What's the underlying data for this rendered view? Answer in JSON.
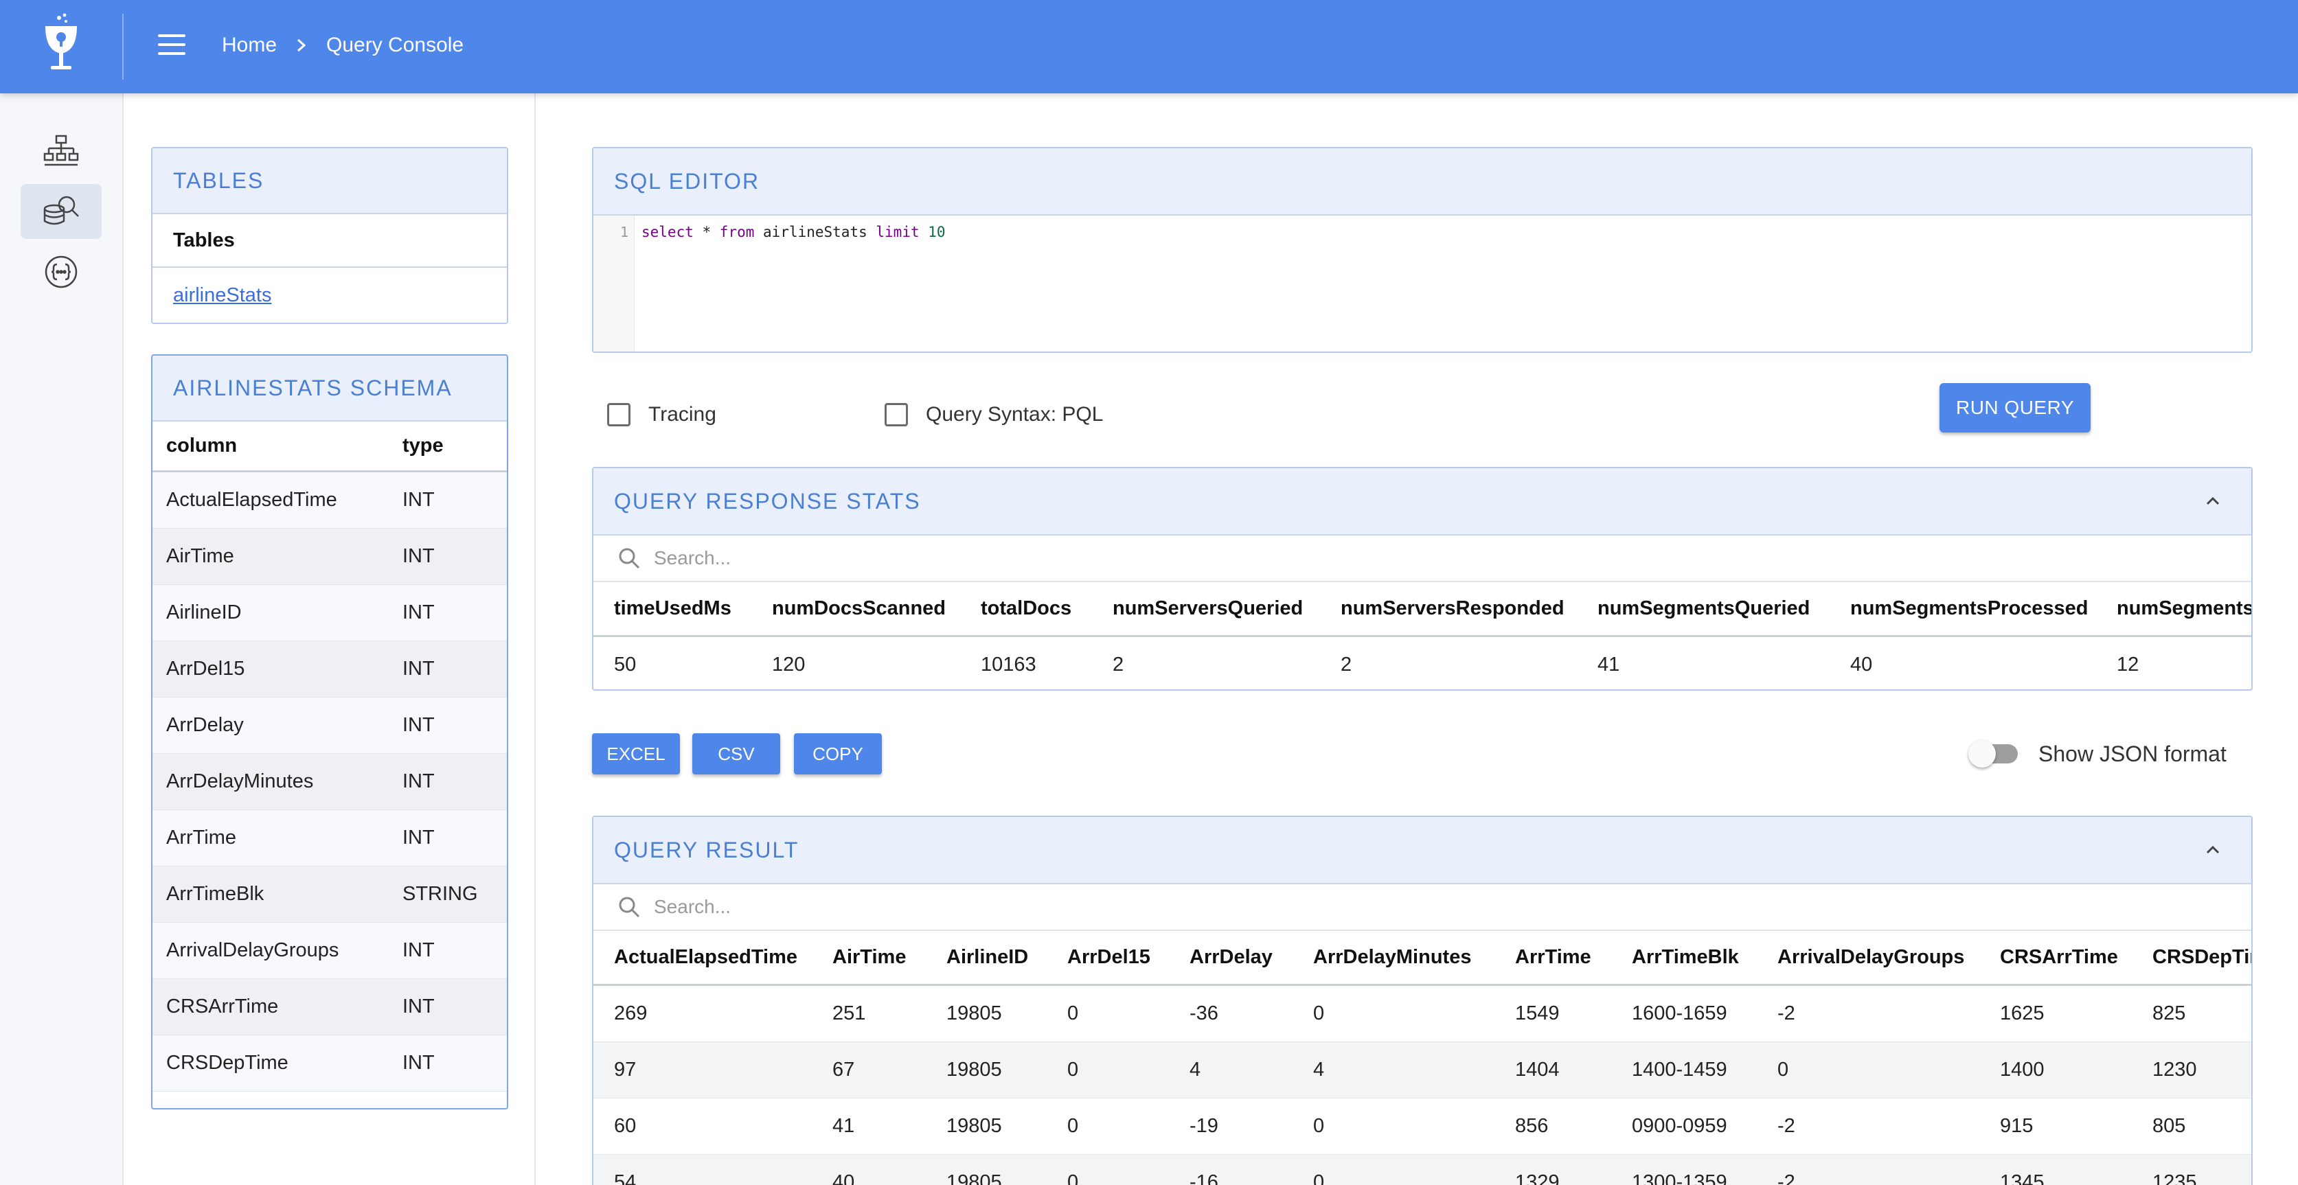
{
  "header": {
    "breadcrumb": [
      "Home",
      "Query Console"
    ],
    "accent": "#4f86ea"
  },
  "rail": {
    "items": [
      {
        "icon": "cluster-icon",
        "active": false
      },
      {
        "icon": "query-console-icon",
        "active": true
      },
      {
        "icon": "swagger-api-icon",
        "active": false
      }
    ]
  },
  "tables_panel": {
    "title": "TABLES",
    "column_header": "Tables",
    "tables": [
      "airlineStats"
    ]
  },
  "schema_panel": {
    "title": "AIRLINESTATS SCHEMA",
    "headers": [
      "column",
      "type"
    ],
    "rows": [
      [
        "ActualElapsedTime",
        "INT"
      ],
      [
        "AirTime",
        "INT"
      ],
      [
        "AirlineID",
        "INT"
      ],
      [
        "ArrDel15",
        "INT"
      ],
      [
        "ArrDelay",
        "INT"
      ],
      [
        "ArrDelayMinutes",
        "INT"
      ],
      [
        "ArrTime",
        "INT"
      ],
      [
        "ArrTimeBlk",
        "STRING"
      ],
      [
        "ArrivalDelayGroups",
        "INT"
      ],
      [
        "CRSArrTime",
        "INT"
      ],
      [
        "CRSDepTime",
        "INT"
      ]
    ]
  },
  "editor": {
    "title": "SQL EDITOR",
    "line_number": "1",
    "query": {
      "kw_select": "select",
      "star": " * ",
      "kw_from": "from",
      "table": " airlineStats ",
      "kw_limit": "limit",
      "num": " 10"
    }
  },
  "options": {
    "tracing_label": "Tracing",
    "tracing_checked": false,
    "syntax_label": "Query Syntax: PQL",
    "syntax_checked": false,
    "run_label": "RUN QUERY"
  },
  "stats": {
    "title": "QUERY RESPONSE STATS",
    "search_placeholder": "Search...",
    "headers": [
      "timeUsedMs",
      "numDocsScanned",
      "totalDocs",
      "numServersQueried",
      "numServersResponded",
      "numSegmentsQueried",
      "numSegmentsProcessed",
      "numSegments"
    ],
    "row": [
      "50",
      "120",
      "10163",
      "2",
      "2",
      "41",
      "40",
      "12"
    ]
  },
  "actions": {
    "excel": "EXCEL",
    "csv": "CSV",
    "copy": "COPY",
    "json_toggle_label": "Show JSON format",
    "json_toggle_on": false
  },
  "result": {
    "title": "QUERY RESULT",
    "search_placeholder": "Search...",
    "headers": [
      "ActualElapsedTime",
      "AirTime",
      "AirlineID",
      "ArrDel15",
      "ArrDelay",
      "ArrDelayMinutes",
      "ArrTime",
      "ArrTimeBlk",
      "ArrivalDelayGroups",
      "CRSArrTime",
      "CRSDepTim"
    ],
    "rows": [
      [
        "269",
        "251",
        "19805",
        "0",
        "-36",
        "0",
        "1549",
        "1600-1659",
        "-2",
        "1625",
        "825"
      ],
      [
        "97",
        "67",
        "19805",
        "0",
        "4",
        "4",
        "1404",
        "1400-1459",
        "0",
        "1400",
        "1230"
      ],
      [
        "60",
        "41",
        "19805",
        "0",
        "-19",
        "0",
        "856",
        "0900-0959",
        "-2",
        "915",
        "805"
      ],
      [
        "54",
        "40",
        "19805",
        "0",
        "-16",
        "0",
        "1329",
        "1300-1359",
        "-2",
        "1345",
        "1235"
      ]
    ]
  }
}
